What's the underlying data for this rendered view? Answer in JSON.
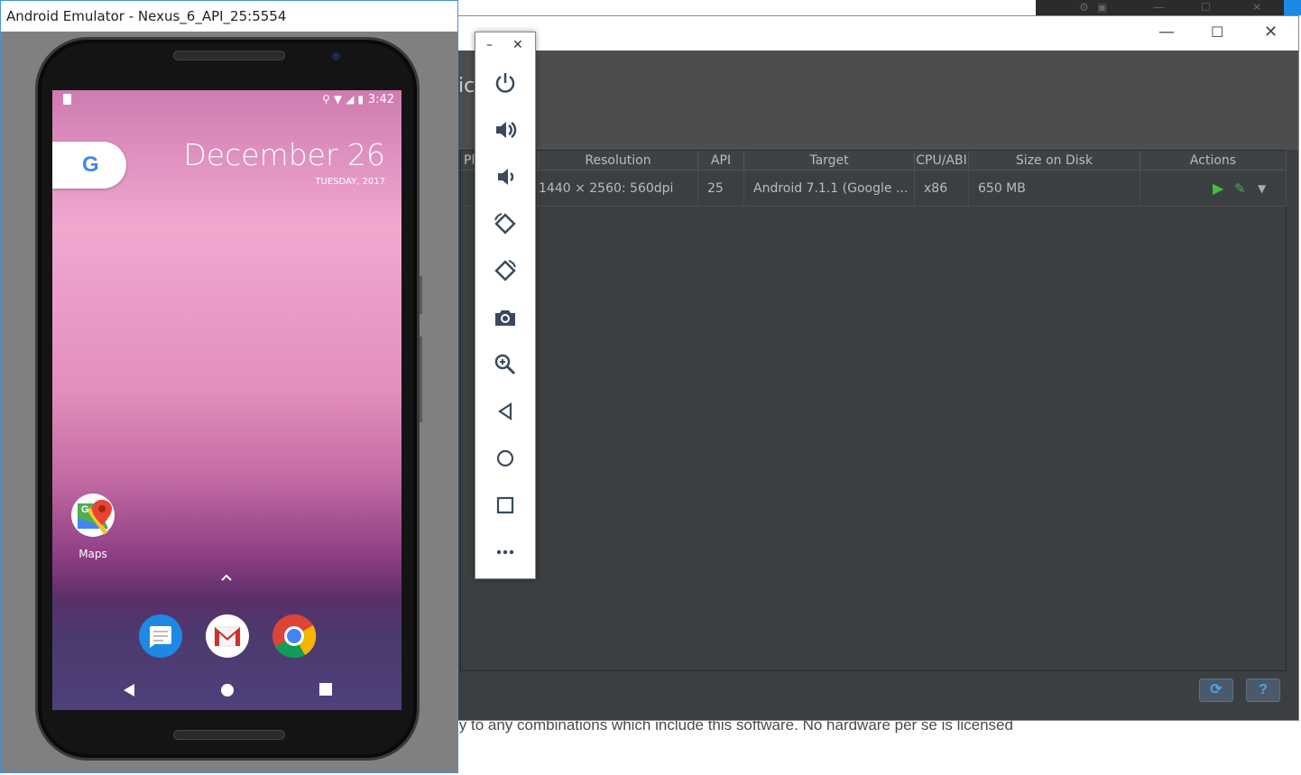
{
  "background": {
    "license_text": "ly to any combinations which include this software. No hardware per se is licensed"
  },
  "avd_manager": {
    "header_partial": "ic",
    "columns": [
      "Pl",
      "Resolution",
      "API",
      "Target",
      "CPU/ABI",
      "Size on Disk",
      "Actions"
    ],
    "rows": [
      {
        "resolution": "1440 × 2560: 560dpi",
        "api": "25",
        "target": "Android 7.1.1 (Google ...",
        "cpu": "x86",
        "size": "650 MB"
      }
    ],
    "footer": {
      "refresh": "⟳",
      "help": "?"
    }
  },
  "emulator": {
    "title": "Android Emulator - Nexus_6_API_25:5554",
    "clock": "3:42",
    "date_big": "December 26",
    "date_small": "TUESDAY, 2017",
    "maps_label": "Maps",
    "google_letter": "G"
  },
  "toolbar": {
    "items": [
      "power",
      "volume-up",
      "volume-down",
      "rotate-left",
      "rotate-right",
      "screenshot",
      "zoom",
      "back",
      "home",
      "overview",
      "more"
    ]
  }
}
